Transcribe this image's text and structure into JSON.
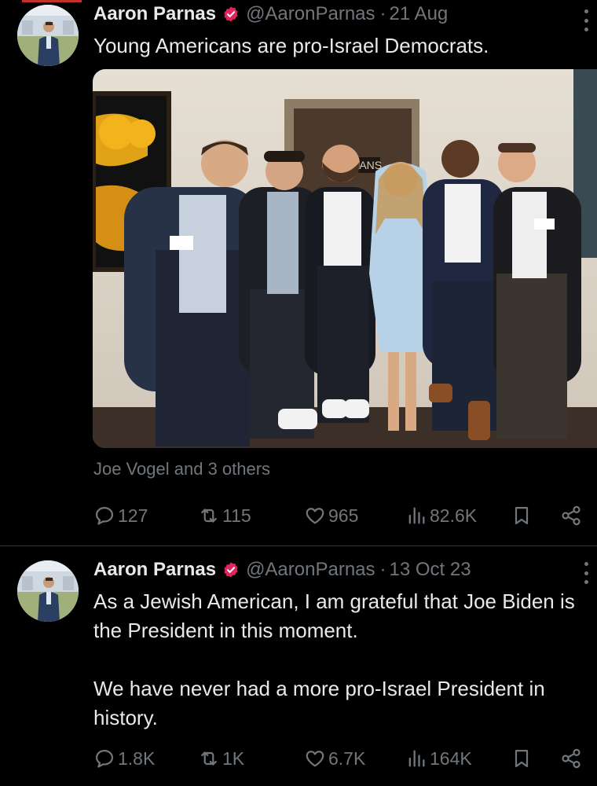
{
  "tweets": [
    {
      "name": "Aaron Parnas",
      "handle": "@AaronParnas",
      "dot": "·",
      "date": "21 Aug",
      "text": "Young Americans are pro-Israel Democrats.",
      "liked_by": "Joe Vogel and 3 others",
      "stats": {
        "replies": "127",
        "retweets": "115",
        "likes": "965",
        "views": "82.6K"
      }
    },
    {
      "name": "Aaron Parnas",
      "handle": "@AaronParnas",
      "dot": "·",
      "date": "13 Oct 23",
      "text": "As a Jewish American, I am grateful that Joe Biden is the President in this moment.\n\nWe have never had a more pro-Israel President in history.",
      "stats": {
        "replies": "1.8K",
        "retweets": "1K",
        "likes": "6.7K",
        "views": "164K"
      }
    }
  ],
  "photo_sign_text": "SANS",
  "icons": [
    "verified-badge-icon",
    "more-icon",
    "reply-icon",
    "retweet-icon",
    "like-icon",
    "views-icon",
    "bookmark-icon",
    "share-icon"
  ],
  "colors": {
    "background": "#000000",
    "text": "#e7e9ea",
    "muted": "#71767b",
    "verified": "#e0245e",
    "accent_bar": "#c4302b"
  }
}
